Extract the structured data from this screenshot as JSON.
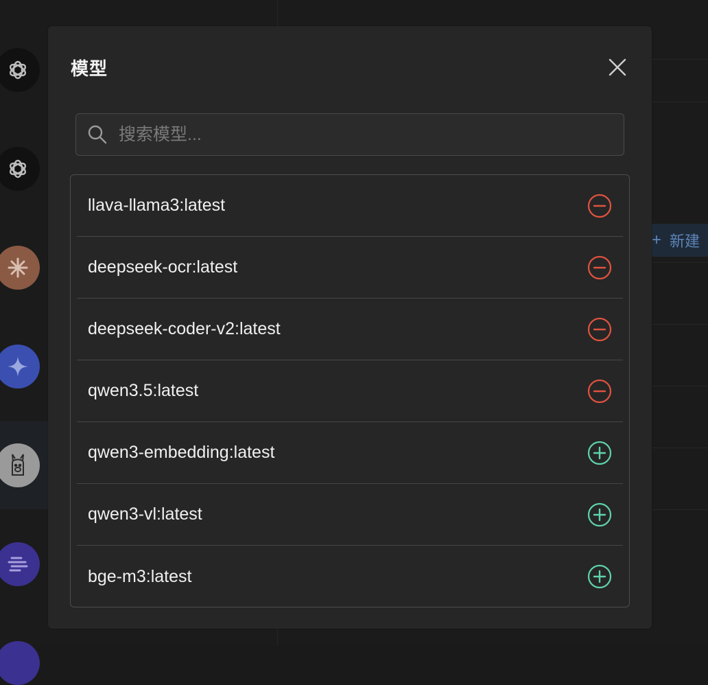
{
  "colors": {
    "remove": "#e0533f",
    "add": "#5fd3ae",
    "modal_bg": "#262626",
    "page_bg": "#1b1b1b"
  },
  "background": {
    "new_button": {
      "icon": "plus-icon",
      "label": "新建"
    },
    "sidebar_avatars": [
      {
        "icon": "openai-logo-icon"
      },
      {
        "icon": "openai-logo-icon"
      },
      {
        "icon": "claude-logo-icon"
      },
      {
        "icon": "gemini-logo-icon"
      },
      {
        "icon": "ollama-llama-icon"
      },
      {
        "icon": "stripes-logo-icon"
      }
    ]
  },
  "modal": {
    "title": "模型",
    "close_icon": "close-icon",
    "search": {
      "icon": "search-icon",
      "placeholder": "搜索模型...",
      "value": ""
    },
    "models": [
      {
        "name": "llava-llama3:latest",
        "state": "added",
        "action_icon": "minus-circle-icon"
      },
      {
        "name": "deepseek-ocr:latest",
        "state": "added",
        "action_icon": "minus-circle-icon"
      },
      {
        "name": "deepseek-coder-v2:latest",
        "state": "added",
        "action_icon": "minus-circle-icon"
      },
      {
        "name": "qwen3.5:latest",
        "state": "added",
        "action_icon": "minus-circle-icon"
      },
      {
        "name": "qwen3-embedding:latest",
        "state": "available",
        "action_icon": "plus-circle-icon"
      },
      {
        "name": "qwen3-vl:latest",
        "state": "available",
        "action_icon": "plus-circle-icon"
      },
      {
        "name": "bge-m3:latest",
        "state": "available",
        "action_icon": "plus-circle-icon"
      }
    ]
  }
}
